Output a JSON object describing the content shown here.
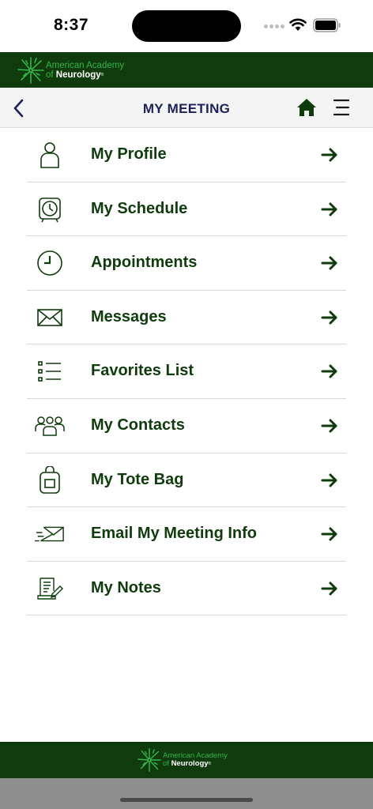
{
  "status_bar": {
    "time": "8:37"
  },
  "brand": {
    "line1": "American Academy",
    "line2_prefix": "of ",
    "line2_bold": "Neurology",
    "trademark": "®",
    "accent_color": "#35b44a",
    "bar_color": "#0f3b0d"
  },
  "nav": {
    "title": "MY MEETING",
    "back_icon": "chevron-left-icon",
    "home_icon": "home-icon",
    "menu_icon": "hamburger-menu-icon"
  },
  "menu": {
    "items": [
      {
        "label": "My Profile",
        "icon": "person-icon"
      },
      {
        "label": "My Schedule",
        "icon": "alarm-clock-icon"
      },
      {
        "label": "Appointments",
        "icon": "clock-icon"
      },
      {
        "label": "Messages",
        "icon": "envelope-icon"
      },
      {
        "label": "Favorites List",
        "icon": "list-icon"
      },
      {
        "label": "My Contacts",
        "icon": "group-icon"
      },
      {
        "label": "My Tote Bag",
        "icon": "tote-bag-icon"
      },
      {
        "label": "Email My Meeting Info",
        "icon": "send-mail-icon"
      },
      {
        "label": "My Notes",
        "icon": "notes-icon"
      }
    ],
    "arrow_icon": "arrow-right-icon",
    "text_color": "#0f3b0d"
  },
  "footer": {
    "line1": "American Academy",
    "line2_prefix": "of ",
    "line2_bold": "Neurology",
    "trademark": "®"
  }
}
